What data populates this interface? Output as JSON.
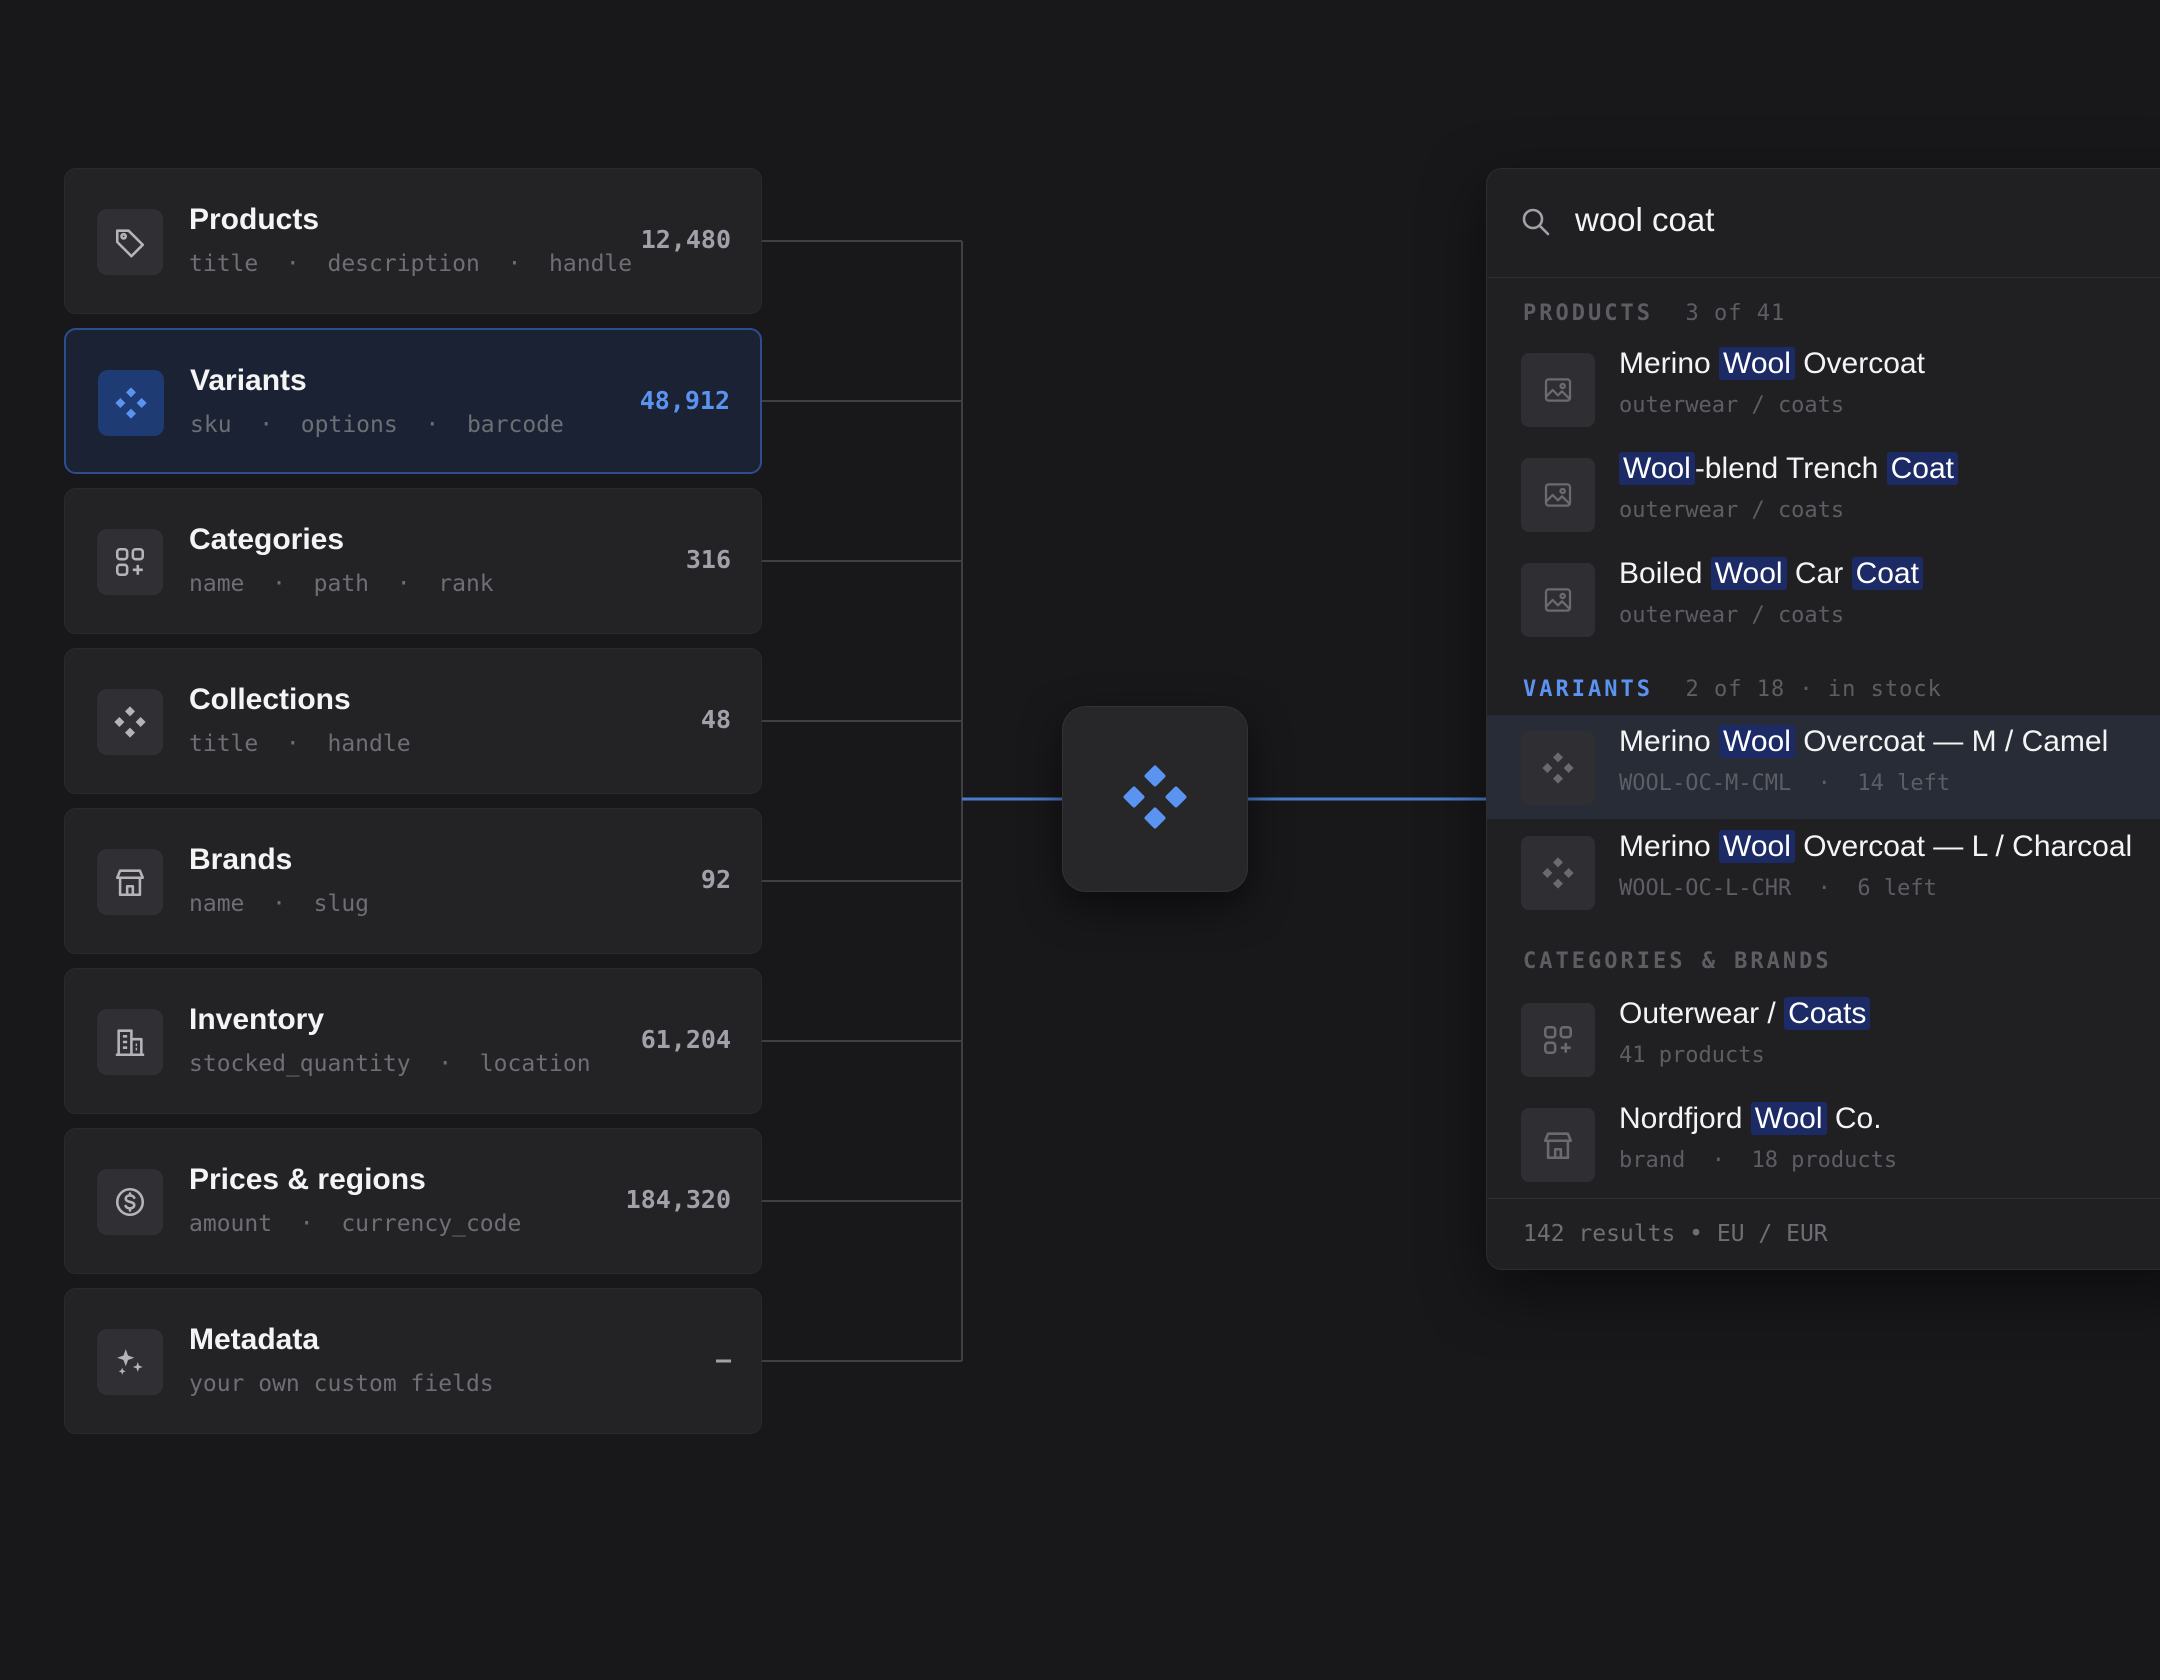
{
  "sources": [
    {
      "name": "Products",
      "fields": "title · description · handle",
      "count": "12,480",
      "icon": "tag-icon",
      "active": false
    },
    {
      "name": "Variants",
      "fields": "sku · options · barcode",
      "count": "48,912",
      "icon": "diamond-cluster-icon",
      "active": true
    },
    {
      "name": "Categories",
      "fields": "name · path · rank",
      "count": "316",
      "icon": "grid-plus-icon",
      "active": false
    },
    {
      "name": "Collections",
      "fields": "title · handle",
      "count": "48",
      "icon": "diamond-cluster-icon",
      "active": false
    },
    {
      "name": "Brands",
      "fields": "name · slug",
      "count": "92",
      "icon": "storefront-icon",
      "active": false
    },
    {
      "name": "Inventory",
      "fields": "stocked_quantity · location",
      "count": "61,204",
      "icon": "building-icon",
      "active": false
    },
    {
      "name": "Prices & regions",
      "fields": "amount · currency_code",
      "count": "184,320",
      "icon": "dollar-circle-icon",
      "active": false
    },
    {
      "name": "Metadata",
      "fields": "your own custom fields",
      "count": "–",
      "icon": "sparkles-icon",
      "active": false
    }
  ],
  "hub": {
    "icon": "diamond-cluster-icon"
  },
  "search": {
    "query": "wool coat",
    "icon": "search-icon",
    "sections": {
      "products": {
        "label": "PRODUCTS",
        "meta": "3 of 41"
      },
      "variants": {
        "label": "VARIANTS",
        "meta": "2 of 18 · in stock"
      },
      "categories": {
        "label": "CATEGORIES & BRANDS"
      }
    },
    "results": [
      {
        "parts": [
          {
            "t": "Merino "
          },
          {
            "t": "Wool",
            "h": true
          },
          {
            "t": " Overcoat"
          }
        ],
        "sub": "outerwear / coats",
        "icon": "image-icon",
        "selected": false
      },
      {
        "parts": [
          {
            "t": "Wool",
            "h": true
          },
          {
            "t": "-blend Trench "
          },
          {
            "t": "Coat",
            "h": true
          }
        ],
        "sub": "outerwear / coats",
        "icon": "image-icon",
        "selected": false
      },
      {
        "parts": [
          {
            "t": "Boiled "
          },
          {
            "t": "Wool",
            "h": true
          },
          {
            "t": " Car "
          },
          {
            "t": "Coat",
            "h": true
          }
        ],
        "sub": "outerwear / coats",
        "icon": "image-icon",
        "selected": false
      },
      {
        "parts": [
          {
            "t": "Merino "
          },
          {
            "t": "Wool",
            "h": true
          },
          {
            "t": " Overcoat — M / Camel"
          }
        ],
        "sub": "WOOL-OC-M-CML · 14 left",
        "icon": "diamond-cluster-icon",
        "selected": true
      },
      {
        "parts": [
          {
            "t": "Merino "
          },
          {
            "t": "Wool",
            "h": true
          },
          {
            "t": " Overcoat — L / Charcoal"
          }
        ],
        "sub": "WOOL-OC-L-CHR · 6 left",
        "icon": "diamond-cluster-icon",
        "selected": false
      },
      {
        "parts": [
          {
            "t": "Outerwear / "
          },
          {
            "t": "Coats",
            "h": true
          }
        ],
        "sub": "41 products",
        "icon": "grid-plus-icon",
        "selected": false
      },
      {
        "parts": [
          {
            "t": "Nordfjord "
          },
          {
            "t": "Wool",
            "h": true
          },
          {
            "t": " Co."
          }
        ],
        "sub": "brand · 18 products",
        "icon": "storefront-icon",
        "selected": false
      }
    ],
    "footer": "142 results • EU / EUR"
  },
  "colors": {
    "accent": "#5b93f0",
    "highlight": "#1c2b66",
    "background": "#18181b"
  }
}
